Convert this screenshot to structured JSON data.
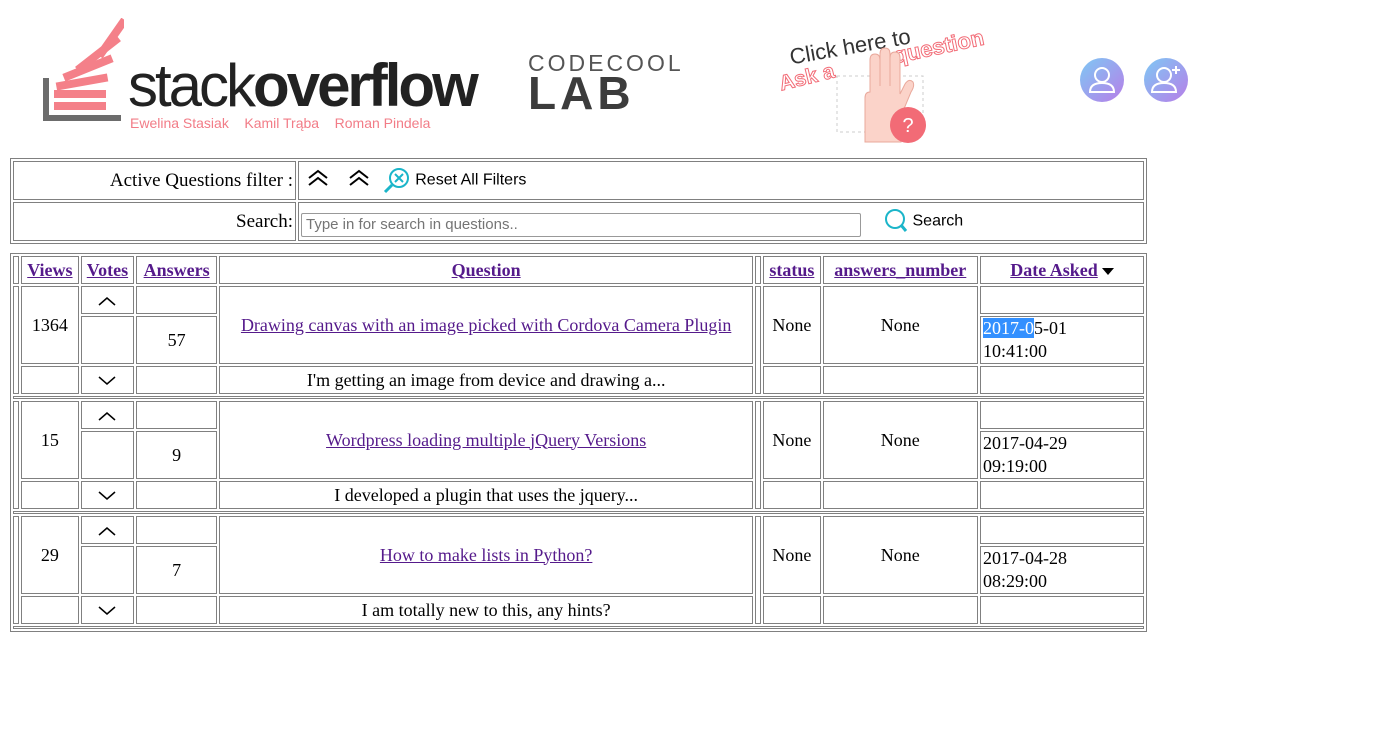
{
  "header": {
    "logo_word_light": "stack",
    "logo_word_bold": "overflow",
    "authors": "Ewelina Stasiak    Kamil Trąba    Roman Pindela",
    "codecool_top": "CODECOOL",
    "codecool_bottom": "LAB",
    "ask_line1": "Click here to",
    "ask_line2": "Ask a",
    "ask_line3": "question",
    "user_icon": "user-icon",
    "add_user_icon": "add-user-icon"
  },
  "filters": {
    "active_label": "Active Questions filter :",
    "reset_label": "Reset All Filters",
    "search_label": "Search:",
    "search_placeholder": "Type in for search in questions..",
    "search_button": "Search"
  },
  "columns": {
    "views": "Views",
    "votes": "Votes",
    "answers": "Answers",
    "question": "Question",
    "status": "status",
    "answers_number": "answers_number",
    "date_asked": "Date Asked"
  },
  "questions": [
    {
      "views": "1364",
      "answers": "57",
      "title": "Drawing canvas with an image picked with Cordova Camera Plugin",
      "excerpt": "I'm getting an image from device and drawing a...",
      "status": "None",
      "answers_number": "None",
      "date_selected": "2017-0",
      "date_rest": "5-01",
      "time": "10:41:00"
    },
    {
      "views": "15",
      "answers": "9",
      "title": "Wordpress loading multiple jQuery Versions",
      "excerpt": "I developed a plugin that uses the jquery...",
      "status": "None",
      "answers_number": "None",
      "date": "2017-04-29",
      "time": "09:19:00"
    },
    {
      "views": "29",
      "answers": "7",
      "title": "How to make lists in Python?",
      "excerpt": "I am totally new to this, any hints?",
      "status": "None",
      "answers_number": "None",
      "date": "2017-04-28",
      "time": "08:29:00"
    }
  ],
  "colors": {
    "link": "#551a8b",
    "brand_pink": "#f26b76",
    "highlight": "#3390ff",
    "teal_icon": "#1bb5c9"
  }
}
